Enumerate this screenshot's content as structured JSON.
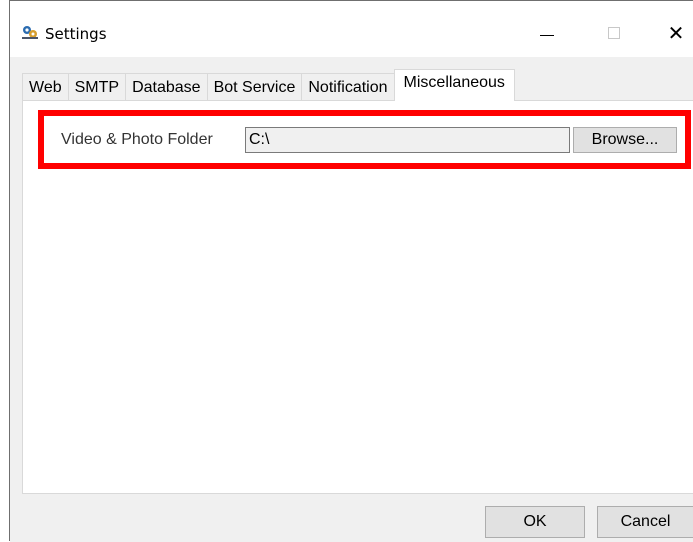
{
  "window": {
    "title": "Settings",
    "minimize_glyph": "—",
    "close_glyph": "✕"
  },
  "tabs": [
    {
      "label": "Web",
      "selected": false
    },
    {
      "label": "SMTP",
      "selected": false
    },
    {
      "label": "Database",
      "selected": false
    },
    {
      "label": "Bot Service",
      "selected": false
    },
    {
      "label": "Notification",
      "selected": false
    },
    {
      "label": "Miscellaneous",
      "selected": true
    }
  ],
  "miscellaneous": {
    "folder_label": "Video & Photo Folder",
    "folder_value": "C:\\",
    "browse_label": "Browse..."
  },
  "buttons": {
    "ok_label": "OK",
    "cancel_label": "Cancel"
  },
  "colors": {
    "highlight": "#ff0000",
    "client_bg": "#f0f0f0",
    "button_bg": "#e1e1e1"
  },
  "icons": {
    "app": "app-gear-icon",
    "minimize": "minimize-icon",
    "maximize": "maximize-icon",
    "close": "close-icon"
  }
}
